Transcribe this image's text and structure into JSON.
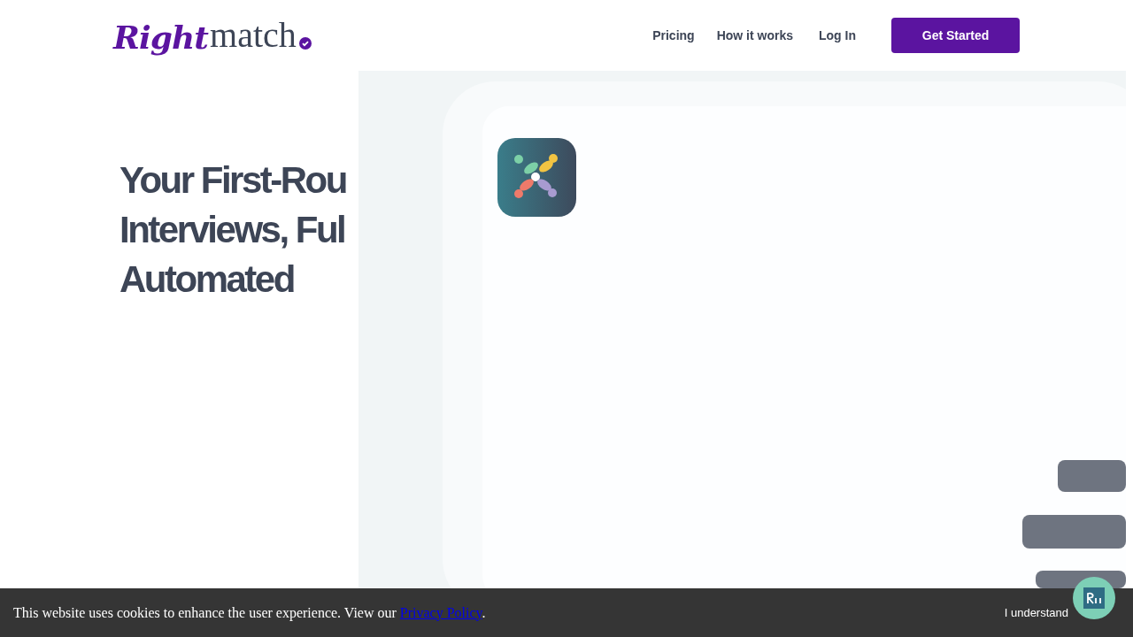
{
  "logo": {
    "part_1": "Right",
    "part_2": "match"
  },
  "nav": {
    "links": [
      "Pricing",
      "How it works",
      "Log In"
    ],
    "cta": "Get Started"
  },
  "hero": {
    "heading_lines": [
      "Your First-Rou",
      "Interviews, Ful",
      "Automated"
    ]
  },
  "cookie_banner": {
    "text_before": "This website uses cookies to enhance the user experience. View our ",
    "link": "Privacy Policy",
    "text_after": ".",
    "button": "I understand"
  }
}
